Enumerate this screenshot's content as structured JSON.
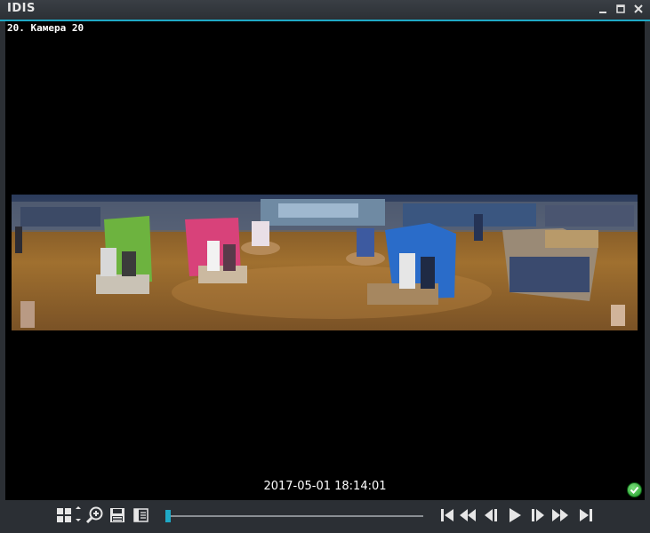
{
  "window": {
    "title": "IDIS",
    "controls": [
      "minimize-icon",
      "maximize-icon",
      "close-icon"
    ]
  },
  "camera": {
    "label": "20. Камера 20",
    "timestamp": "2017-05-01 18:14:01",
    "status": "ok"
  },
  "toolbar": {
    "left_icons": [
      "layout-grid-icon",
      "arrow-toggle-icon",
      "zoom-in-icon",
      "save-icon",
      "panel-icon"
    ],
    "playback_position": 0.0,
    "playback_icons": [
      "go-to-start-icon",
      "rewind-icon",
      "step-back-icon",
      "play-icon",
      "step-forward-icon",
      "fast-forward-icon",
      "go-to-end-icon"
    ]
  },
  "colors": {
    "accent": "#1fa9c6",
    "status_ok": "#2db33a"
  }
}
